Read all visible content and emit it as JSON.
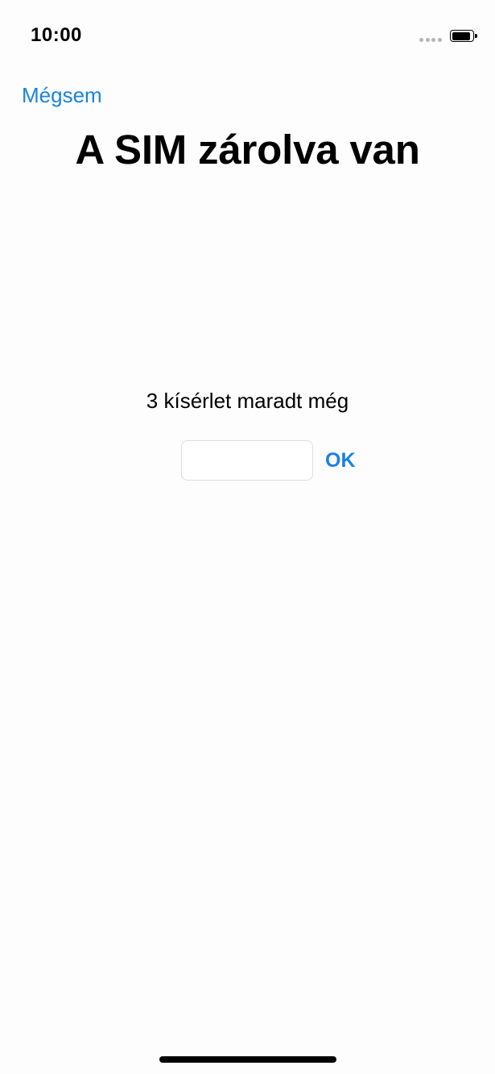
{
  "status_bar": {
    "time": "10:00",
    "signal_icon": "signal-dots-icon",
    "battery_icon": "battery-icon",
    "battery_level": 0.9
  },
  "nav": {
    "cancel_label": "Mégsem"
  },
  "main": {
    "title": "A SIM zárolva van",
    "attempts_text": "3 kísérlet maradt még",
    "pin_input": {
      "value": "",
      "placeholder": ""
    },
    "ok_label": "OK"
  },
  "colors": {
    "accent": "#1a82e2",
    "background": "#fdfdfd",
    "text": "#000000"
  }
}
